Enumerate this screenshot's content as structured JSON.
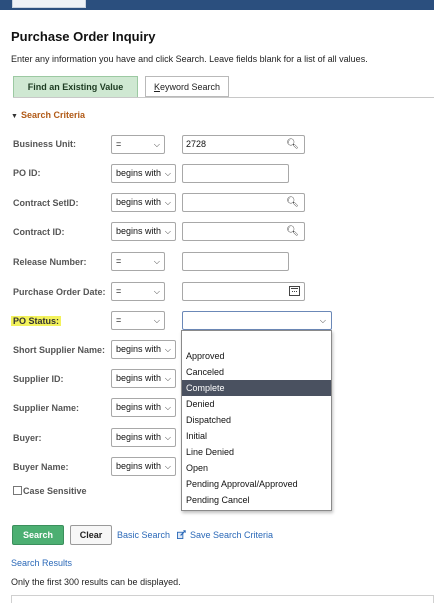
{
  "page": {
    "title": "Purchase Order Inquiry",
    "instructions": "Enter any information you have and click Search. Leave fields blank for a list of all values."
  },
  "tabs": [
    {
      "label": "Find an Existing Value"
    },
    {
      "label": "Keyword Search"
    }
  ],
  "section": {
    "label": "Search Criteria"
  },
  "fields": {
    "business_unit": {
      "label": "Business Unit:",
      "operator": "=",
      "value": "2728"
    },
    "po_id": {
      "label": "PO ID:",
      "operator": "begins with",
      "value": ""
    },
    "contract_setid": {
      "label": "Contract SetID:",
      "operator": "begins with",
      "value": ""
    },
    "contract_id": {
      "label": "Contract ID:",
      "operator": "begins with",
      "value": ""
    },
    "release_number": {
      "label": "Release Number:",
      "operator": "=",
      "value": ""
    },
    "po_date": {
      "label": "Purchase Order Date:",
      "operator": "=",
      "value": ""
    },
    "po_status": {
      "label": "PO Status:",
      "operator": "=",
      "value": ""
    },
    "short_supplier": {
      "label": "Short Supplier Name:",
      "operator": "begins with"
    },
    "supplier_id": {
      "label": "Supplier ID:",
      "operator": "begins with"
    },
    "supplier_name": {
      "label": "Supplier Name:",
      "operator": "begins with"
    },
    "buyer": {
      "label": "Buyer:",
      "operator": "begins with"
    },
    "buyer_name": {
      "label": "Buyer Name:",
      "operator": "begins with"
    }
  },
  "status_options": [
    "",
    "Approved",
    "Canceled",
    "Complete",
    "Denied",
    "Dispatched",
    "Initial",
    "Line Denied",
    "Open",
    "Pending Approval/Approved",
    "Pending Cancel"
  ],
  "status_highlighted": "Complete",
  "case_sensitive": {
    "label": "Case Sensitive",
    "checked": false
  },
  "buttons": {
    "search": "Search",
    "clear": "Clear",
    "basic_search": "Basic Search",
    "save_criteria": "Save Search Criteria"
  },
  "results": {
    "title": "Search Results",
    "note": "Only the first 300 results can be displayed."
  },
  "colors": {
    "accent_section": "#b15a17",
    "tab_active_bg": "#cfe8d2",
    "search_button": "#4caf72",
    "link": "#2b69b8",
    "highlight": "#f3f25b",
    "selected_option_bg": "#4a5160"
  }
}
